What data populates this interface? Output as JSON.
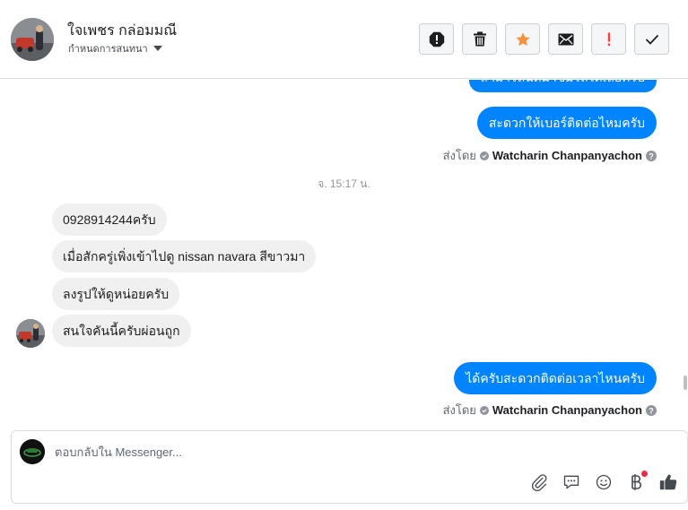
{
  "header": {
    "contact_name": "ใจเพชร กล่อมมณี",
    "assign_label": "กำหนดการสนทนา",
    "actions": [
      {
        "name": "report-icon"
      },
      {
        "name": "trash-icon"
      },
      {
        "name": "star-icon"
      },
      {
        "name": "mail-icon"
      },
      {
        "name": "exclamation-icon"
      },
      {
        "name": "check-icon"
      }
    ]
  },
  "thread": {
    "messages_out_top": [
      {
        "text": "สามารถนัดมาชมรถได้เลยครับ"
      },
      {
        "text": "สะดวกให้เบอร์ติดต่อไหมครับ"
      }
    ],
    "sent_by_1": {
      "prefix": "ส่งโดย",
      "agent": "Watcharin Chanpanyachon"
    },
    "time_separator": "จ. 15:17 น.",
    "messages_in": [
      {
        "text": "0928914244ครับ"
      },
      {
        "text": "เมื่อสักครู่เพิ่งเข้าไปดู nissan navara สีขาวมา"
      },
      {
        "text": "ลงรูปให้ดูหน่อยครับ"
      },
      {
        "text": "สนใจคันนี้ครับผ่อนถูก"
      }
    ],
    "message_out_bottom": {
      "text": "ได้ครับสะดวกติดต่อเวลาไหนครับ"
    },
    "sent_by_2": {
      "prefix": "ส่งโดย",
      "agent": "Watcharin Chanpanyachon"
    }
  },
  "composer": {
    "placeholder": "ตอบกลับใน Messenger...",
    "tools": [
      "paperclip-icon",
      "saved-reply-icon",
      "emoji-icon",
      "baht-icon",
      "thumbs-up-icon"
    ]
  },
  "colors": {
    "accent": "#0084ff",
    "incoming_bubble": "#f1f0f0",
    "star": "#f7923b",
    "alert": "#fa3e3e",
    "notification": "#f02849"
  }
}
